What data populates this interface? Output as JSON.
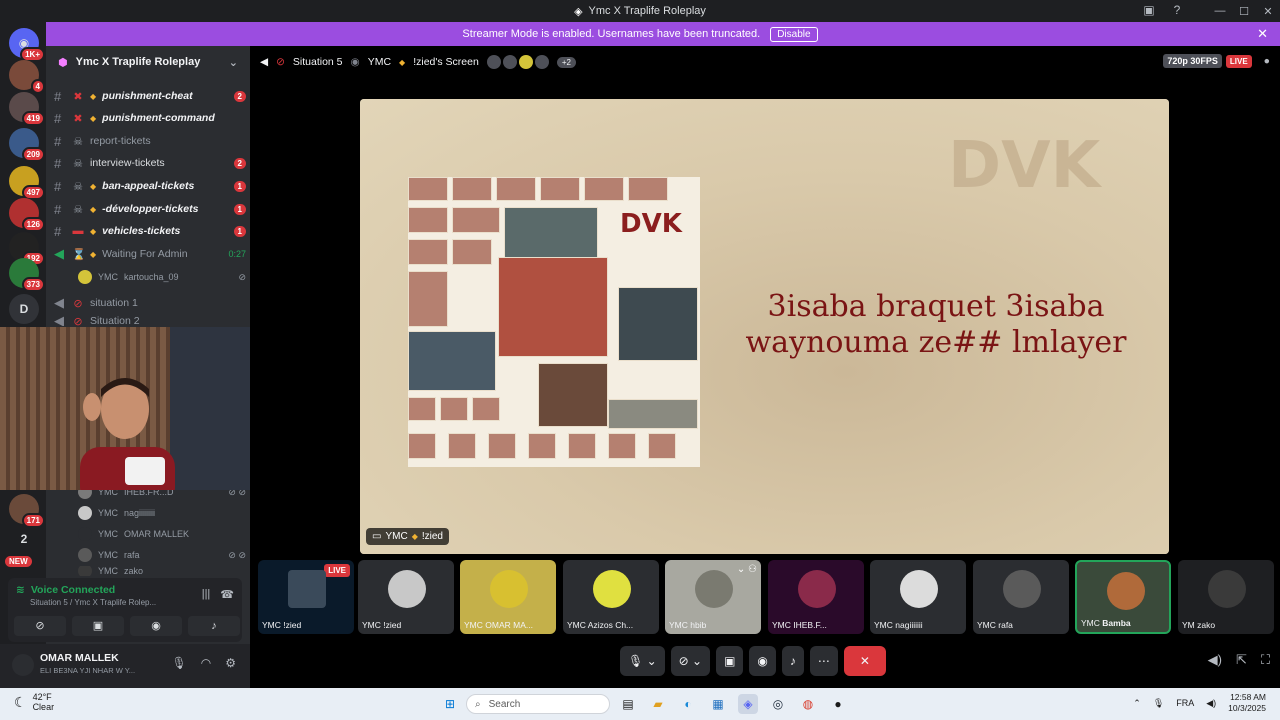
{
  "window": {
    "title": "Ymc X Traplife Roleplay"
  },
  "banner": {
    "text": "Streamer Mode is enabled. Usernames have been truncated.",
    "button": "Disable"
  },
  "guilds": [
    {
      "badge": "1K+"
    },
    {
      "badge": "4"
    },
    {
      "badge": "419"
    },
    {
      "badge": "209"
    },
    {
      "badge": "497"
    },
    {
      "badge": "126"
    },
    {
      "badge": "192"
    },
    {
      "badge": "373"
    },
    {
      "text": "D"
    },
    {
      "badge": "171"
    },
    {
      "text": "2"
    },
    {
      "badge": "NEW"
    }
  ],
  "server": {
    "name": "Ymc X Traplife Roleplay"
  },
  "channels": [
    {
      "name": "punishment-cheat",
      "count": "2",
      "bold": true
    },
    {
      "name": "punishment-command",
      "count": "",
      "bold": true
    },
    {
      "name": "report-tickets",
      "count": "",
      "bold": false
    },
    {
      "name": "interview-tickets",
      "count": "2",
      "bold": false
    },
    {
      "name": "ban-appeal-tickets",
      "count": "1",
      "bold": true
    },
    {
      "name": "-développer-tickets",
      "count": "1",
      "bold": true
    },
    {
      "name": "vehicles-tickets",
      "count": "1",
      "bold": true
    }
  ],
  "waiting": {
    "name": "Waiting For Admin",
    "time": "0:27",
    "user_prefix": "YMC",
    "user": "kartoucha_09"
  },
  "situation1": {
    "name": "situation 1"
  },
  "situation2": {
    "name": "Situation 2"
  },
  "voice_users": [
    {
      "prefix": "YMC",
      "name": "IHEB.FR...D"
    },
    {
      "prefix": "YMC",
      "name": "nagiiiiiiii"
    },
    {
      "prefix": "YMC",
      "name": "OMAR MALLEK"
    },
    {
      "prefix": "YMC",
      "name": "rafa"
    },
    {
      "prefix": "YMC",
      "name": "zako"
    }
  ],
  "voice": {
    "status": "Voice Connected",
    "sub": "Situation 5 / Ymc X Traplife Rolep..."
  },
  "user": {
    "name": "OMAR MALLEK",
    "status": "ELI BE3NA YJI NHAR W Y..."
  },
  "topbar": {
    "channel": "Situation 5",
    "prefix": "YMC",
    "screen": "!zied's Screen",
    "more": "+2",
    "quality": "720p 30FPS",
    "live": "LIVE"
  },
  "stage": {
    "dvk_bg": "DVK",
    "dvk": "DVK",
    "lyric1": "3isaba braquet 3isaba",
    "lyric2": "waynouma ze## lmlayer",
    "label_prefix": "YMC",
    "label_name": "!zied"
  },
  "tiles": [
    {
      "prefix": "YMC",
      "name": "!zied",
      "live": "LIVE"
    },
    {
      "prefix": "YMC",
      "name": "!zied"
    },
    {
      "prefix": "YMC",
      "name": "OMAR MA..."
    },
    {
      "prefix": "YMC",
      "name": "Azizos Ch..."
    },
    {
      "prefix": "YMC",
      "name": "hbib"
    },
    {
      "prefix": "YMC",
      "name": "IHEB.F..."
    },
    {
      "prefix": "YMC",
      "name": "nagiiiiiii"
    },
    {
      "prefix": "YMC",
      "name": "rafa"
    },
    {
      "prefix": "YMC",
      "name": "Bamba"
    },
    {
      "prefix": "YM",
      "name": "zako"
    }
  ],
  "taskbar": {
    "temp": "42°F",
    "weather": "Clear",
    "search": "Search",
    "lang": "FRA",
    "time": "12:58 AM",
    "date": "10/3/2025"
  },
  "colors": {
    "accent": "#9b4de0",
    "live": "#da373c",
    "connected": "#23a55a"
  }
}
